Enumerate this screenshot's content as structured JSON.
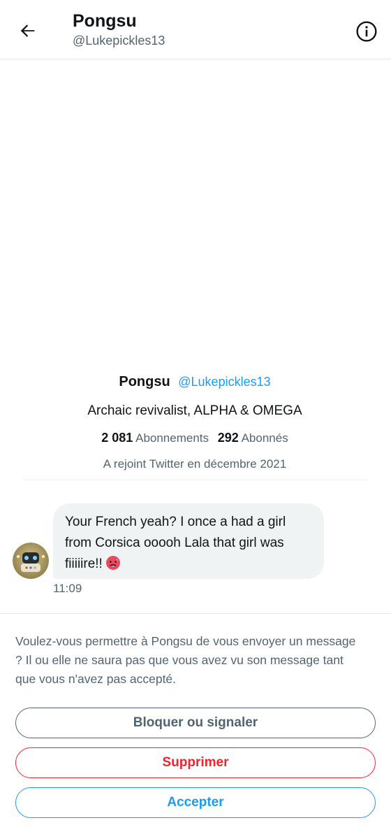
{
  "header": {
    "title": "Pongsu",
    "handle": "@Lukepickles13",
    "back_icon": "arrow-left-icon",
    "info_icon": "info-circle-icon"
  },
  "profile": {
    "name": "Pongsu",
    "handle": "@Lukepickles13",
    "bio": "Archaic revivalist, ALPHA & OMEGA",
    "following_count": "2 081",
    "following_label": "Abonnements",
    "followers_count": "292",
    "followers_label": "Abonnés",
    "joined": "A rejoint Twitter en décembre 2021"
  },
  "message": {
    "text": "Your French yeah? I once a had a girl from Corsica ooooh Lala that girl was fiiiiire!!",
    "emoji": "hot-face-emoji",
    "time": "11:09"
  },
  "request": {
    "text": "Voulez-vous permettre à Pongsu de vous envoyer un message ? Il ou elle ne saura pas que vous avez vu son message tant que vous n'avez pas accepté."
  },
  "actions": {
    "block_label": "Bloquer ou signaler",
    "delete_label": "Supprimer",
    "accept_label": "Accepter"
  },
  "colors": {
    "accent": "#1d9bf0",
    "danger": "#f4212e",
    "secondary_text": "#536471",
    "bubble": "#eff3f4"
  }
}
